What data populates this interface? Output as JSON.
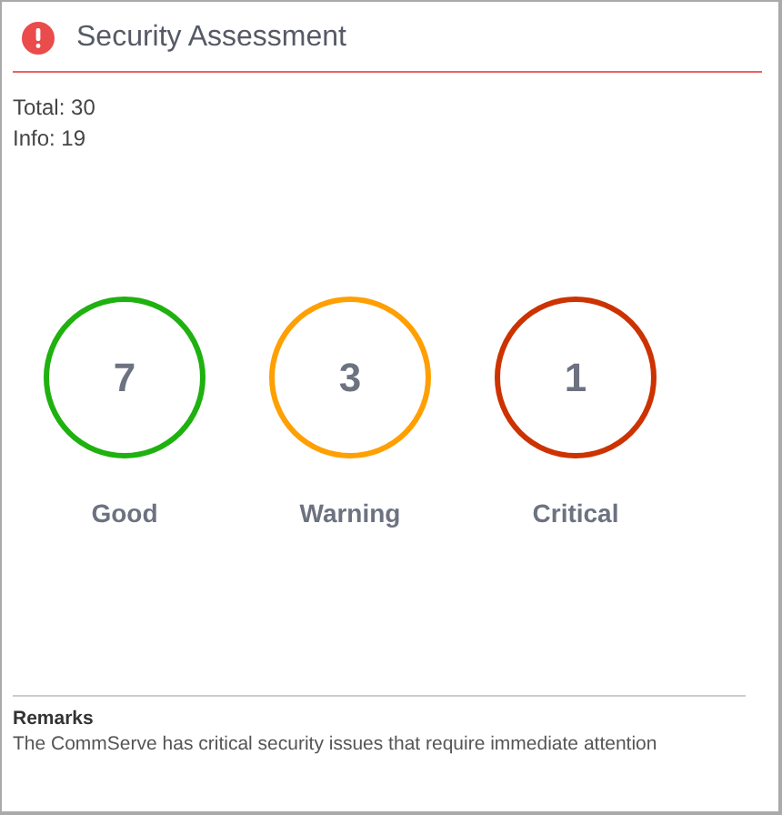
{
  "title": "Security Assessment",
  "summary": [
    "Total: 30",
    "Info: 19"
  ],
  "statuses": [
    {
      "count": "7",
      "label": "Good",
      "color": "#1fb10f"
    },
    {
      "count": "3",
      "label": "Warning",
      "color": "#ff9f00"
    },
    {
      "count": "1",
      "label": "Critical",
      "color": "#cc3300"
    }
  ],
  "remarks": {
    "heading": "Remarks",
    "text": "The CommServe has critical security issues that require immediate attention"
  }
}
